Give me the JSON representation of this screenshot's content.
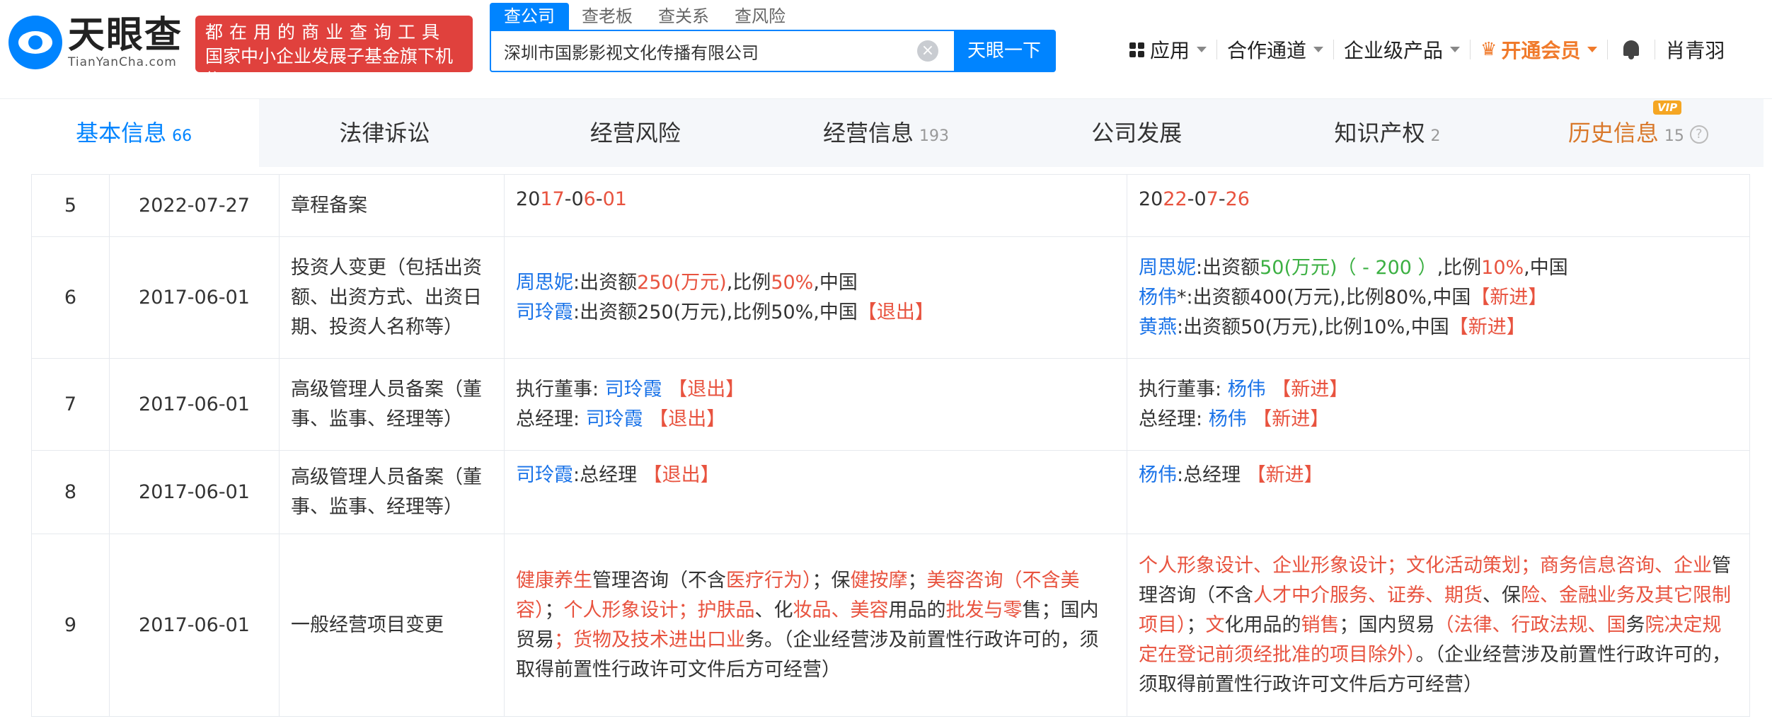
{
  "header": {
    "logo_cn": "天眼查",
    "logo_en": "TianYanCha.com",
    "promo_line1": "都在用的商业查询工具",
    "promo_line2": "国家中小企业发展子基金旗下机构",
    "search_tabs": [
      "查公司",
      "查老板",
      "查关系",
      "查风险"
    ],
    "search_value": "深圳市国影影视文化传播有限公司",
    "search_button": "天眼一下",
    "nav": {
      "apps": "应用",
      "cooperation": "合作通道",
      "enterprise": "企业级产品",
      "vip": "开通会员",
      "user": "肖青羽"
    }
  },
  "section_tabs": [
    {
      "label": "基本信息",
      "count": "66"
    },
    {
      "label": "法律诉讼",
      "count": ""
    },
    {
      "label": "经营风险",
      "count": ""
    },
    {
      "label": "经营信息",
      "count": "193"
    },
    {
      "label": "公司发展",
      "count": ""
    },
    {
      "label": "知识产权",
      "count": "2"
    },
    {
      "label": "历史信息",
      "count": "15",
      "badge": "VIP"
    }
  ],
  "table": {
    "rows": [
      {
        "no": "5",
        "date": "2022-07-27",
        "item": "章程备案",
        "before": [
          [
            [
              "2",
              "t"
            ],
            [
              "0",
              "t"
            ],
            [
              "17",
              "r"
            ],
            [
              "-",
              "t"
            ],
            [
              "0",
              "t"
            ],
            [
              "6",
              "r"
            ],
            [
              "-",
              "t"
            ],
            [
              "01",
              "r"
            ]
          ]
        ],
        "after": [
          [
            [
              "20",
              "t"
            ],
            [
              "22",
              "r"
            ],
            [
              "-",
              "t"
            ],
            [
              "0",
              "t"
            ],
            [
              "7",
              "r"
            ],
            [
              "-",
              "t"
            ],
            [
              "26",
              "r"
            ]
          ]
        ]
      },
      {
        "no": "6",
        "date": "2017-06-01",
        "item": "投资人变更（包括出资额、出资方式、出资日期、投资人名称等）",
        "before": [
          [
            [
              "周思妮",
              "b"
            ],
            [
              ":出资额",
              "t"
            ],
            [
              "250(万元)",
              "r"
            ],
            [
              ",比例",
              "t"
            ],
            [
              "50%",
              "r"
            ],
            [
              ",中国",
              "t"
            ]
          ],
          [
            [
              "司玲霞",
              "b"
            ],
            [
              ":出资额250(万元),比例50%,中国",
              "t"
            ],
            [
              "【退出】",
              "r"
            ]
          ]
        ],
        "after": [
          [
            [
              "周思妮",
              "b"
            ],
            [
              ":出资额",
              "t"
            ],
            [
              "50(万元)（ - 200 ）",
              "g"
            ],
            [
              ",比例",
              "t"
            ],
            [
              "10%",
              "r"
            ],
            [
              ",中国",
              "t"
            ]
          ],
          [
            [
              "杨伟",
              "b"
            ],
            [
              "*:出资额400(万元),比例80%,中国",
              "t"
            ],
            [
              "【新进】",
              "r"
            ]
          ],
          [
            [
              "黄燕",
              "b"
            ],
            [
              ":出资额50(万元),比例10%,中国",
              "t"
            ],
            [
              "【新进】",
              "r"
            ]
          ]
        ]
      },
      {
        "no": "7",
        "date": "2017-06-01",
        "item": "高级管理人员备案（董事、监事、经理等）",
        "before": [
          [
            [
              "执行董事:  ",
              "t"
            ],
            [
              "司玲霞",
              "b"
            ],
            [
              " 【退出】",
              "r"
            ]
          ],
          [
            [
              "总经理:  ",
              "t"
            ],
            [
              "司玲霞",
              "b"
            ],
            [
              " 【退出】",
              "r"
            ]
          ]
        ],
        "after": [
          [
            [
              "执行董事:  ",
              "t"
            ],
            [
              "杨伟",
              "b"
            ],
            [
              " 【新进】",
              "r"
            ]
          ],
          [
            [
              "总经理:  ",
              "t"
            ],
            [
              "杨伟",
              "b"
            ],
            [
              " 【新进】",
              "r"
            ]
          ]
        ]
      },
      {
        "no": "8",
        "date": "2017-06-01",
        "item": "高级管理人员备案（董事、监事、经理等）",
        "before": [
          [
            [
              "司玲霞",
              "b"
            ],
            [
              ":总经理 ",
              "t"
            ],
            [
              "【退出】",
              "r"
            ]
          ]
        ],
        "after": [
          [
            [
              "杨伟",
              "b"
            ],
            [
              ":总经理 ",
              "t"
            ],
            [
              "【新进】",
              "r"
            ]
          ]
        ]
      },
      {
        "no": "9",
        "date": "2017-06-01",
        "item": "一般经营项目变更",
        "before": [
          [
            [
              "健康养生",
              "r"
            ],
            [
              "管理咨询（不含",
              "t"
            ],
            [
              "医疗行为）",
              "r"
            ],
            [
              "；保",
              "t"
            ],
            [
              "健按摩",
              "r"
            ],
            [
              "；",
              "t"
            ],
            [
              "美容咨询（不含美容）",
              "r"
            ],
            [
              "；",
              "t"
            ],
            [
              "个人形象设计；护肤品",
              "r"
            ],
            [
              "、化",
              "t"
            ],
            [
              "妆品、美容",
              "r"
            ],
            [
              "用品的",
              "t"
            ],
            [
              "批发与零",
              "r"
            ],
            [
              "售；国内贸易",
              "t"
            ],
            [
              "；货物及技术进出口业",
              "r"
            ],
            [
              "务。（企业经营涉及前置性行政许可的，须取得前置性行政许可文件后方可经营）",
              "t"
            ]
          ]
        ],
        "after": [
          [
            [
              "个人形象设计、企业形象设计；文化活动策划；商务信息咨询、企业",
              "r"
            ],
            [
              "管理咨询（不含",
              "t"
            ],
            [
              "人才中介服务、证券、期货",
              "r"
            ],
            [
              "、保",
              "t"
            ],
            [
              "险、金融业务及其它限制项目）",
              "r"
            ],
            [
              "；",
              "t"
            ],
            [
              "文",
              "r"
            ],
            [
              "化用品的",
              "t"
            ],
            [
              "销售",
              "r"
            ],
            [
              "；国内贸易",
              "t"
            ],
            [
              "（法律、行政法规、国",
              "r"
            ],
            [
              "务",
              "t"
            ],
            [
              "院决定规定在登记前须经批准的项目除外）",
              "r"
            ],
            [
              "。（企业经营涉及前置性行政许可的，须取得前置性行政许可文件后方可经营）",
              "t"
            ]
          ]
        ]
      }
    ]
  },
  "colors": {
    "accent": "#0084ff",
    "link": "#1a73e8",
    "highlight": "#e8533f",
    "increase": "#3cb043",
    "vip": "#f07a2b"
  }
}
